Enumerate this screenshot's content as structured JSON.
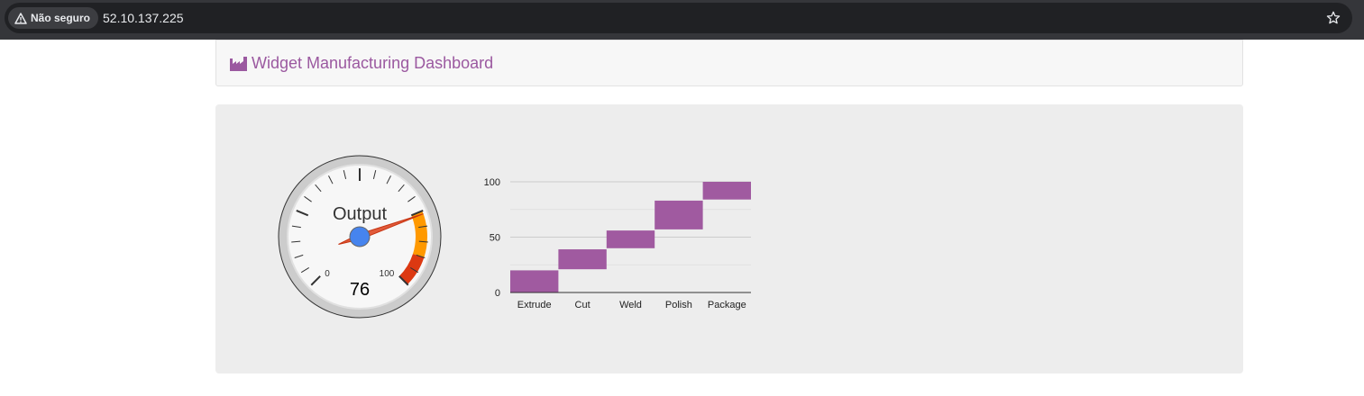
{
  "browser": {
    "security_label": "Não seguro",
    "url": "52.10.137.225",
    "icons": {
      "warning": "warning-triangle-icon",
      "bookmark": "star-icon"
    }
  },
  "header": {
    "title": "Widget Manufacturing Dashboard",
    "icon": "factory-icon",
    "title_color": "#9b59a0"
  },
  "gauge": {
    "label": "Output",
    "value": 76,
    "min_label": "0",
    "max_label": "100",
    "min": 0,
    "max": 100,
    "yellow_from": 75,
    "yellow_to": 90,
    "red_from": 90,
    "red_to": 100,
    "colors": {
      "yellow": "#ff9900",
      "red": "#dc3912",
      "needle": "#e05a3a",
      "hub": "#4684ee"
    }
  },
  "chart_data": {
    "type": "waterfall",
    "categories": [
      "Extrude",
      "Cut",
      "Weld",
      "Polish",
      "Package"
    ],
    "segments": [
      {
        "category": "Extrude",
        "low": 0,
        "high": 20
      },
      {
        "category": "Cut",
        "low": 21,
        "high": 39
      },
      {
        "category": "Weld",
        "low": 40,
        "high": 56
      },
      {
        "category": "Polish",
        "low": 57,
        "high": 83
      },
      {
        "category": "Package",
        "low": 84,
        "high": 100
      }
    ],
    "yticks": [
      "0",
      "50",
      "100"
    ],
    "ylim": [
      0,
      100
    ],
    "grid": true,
    "color": "#a05aa0"
  }
}
